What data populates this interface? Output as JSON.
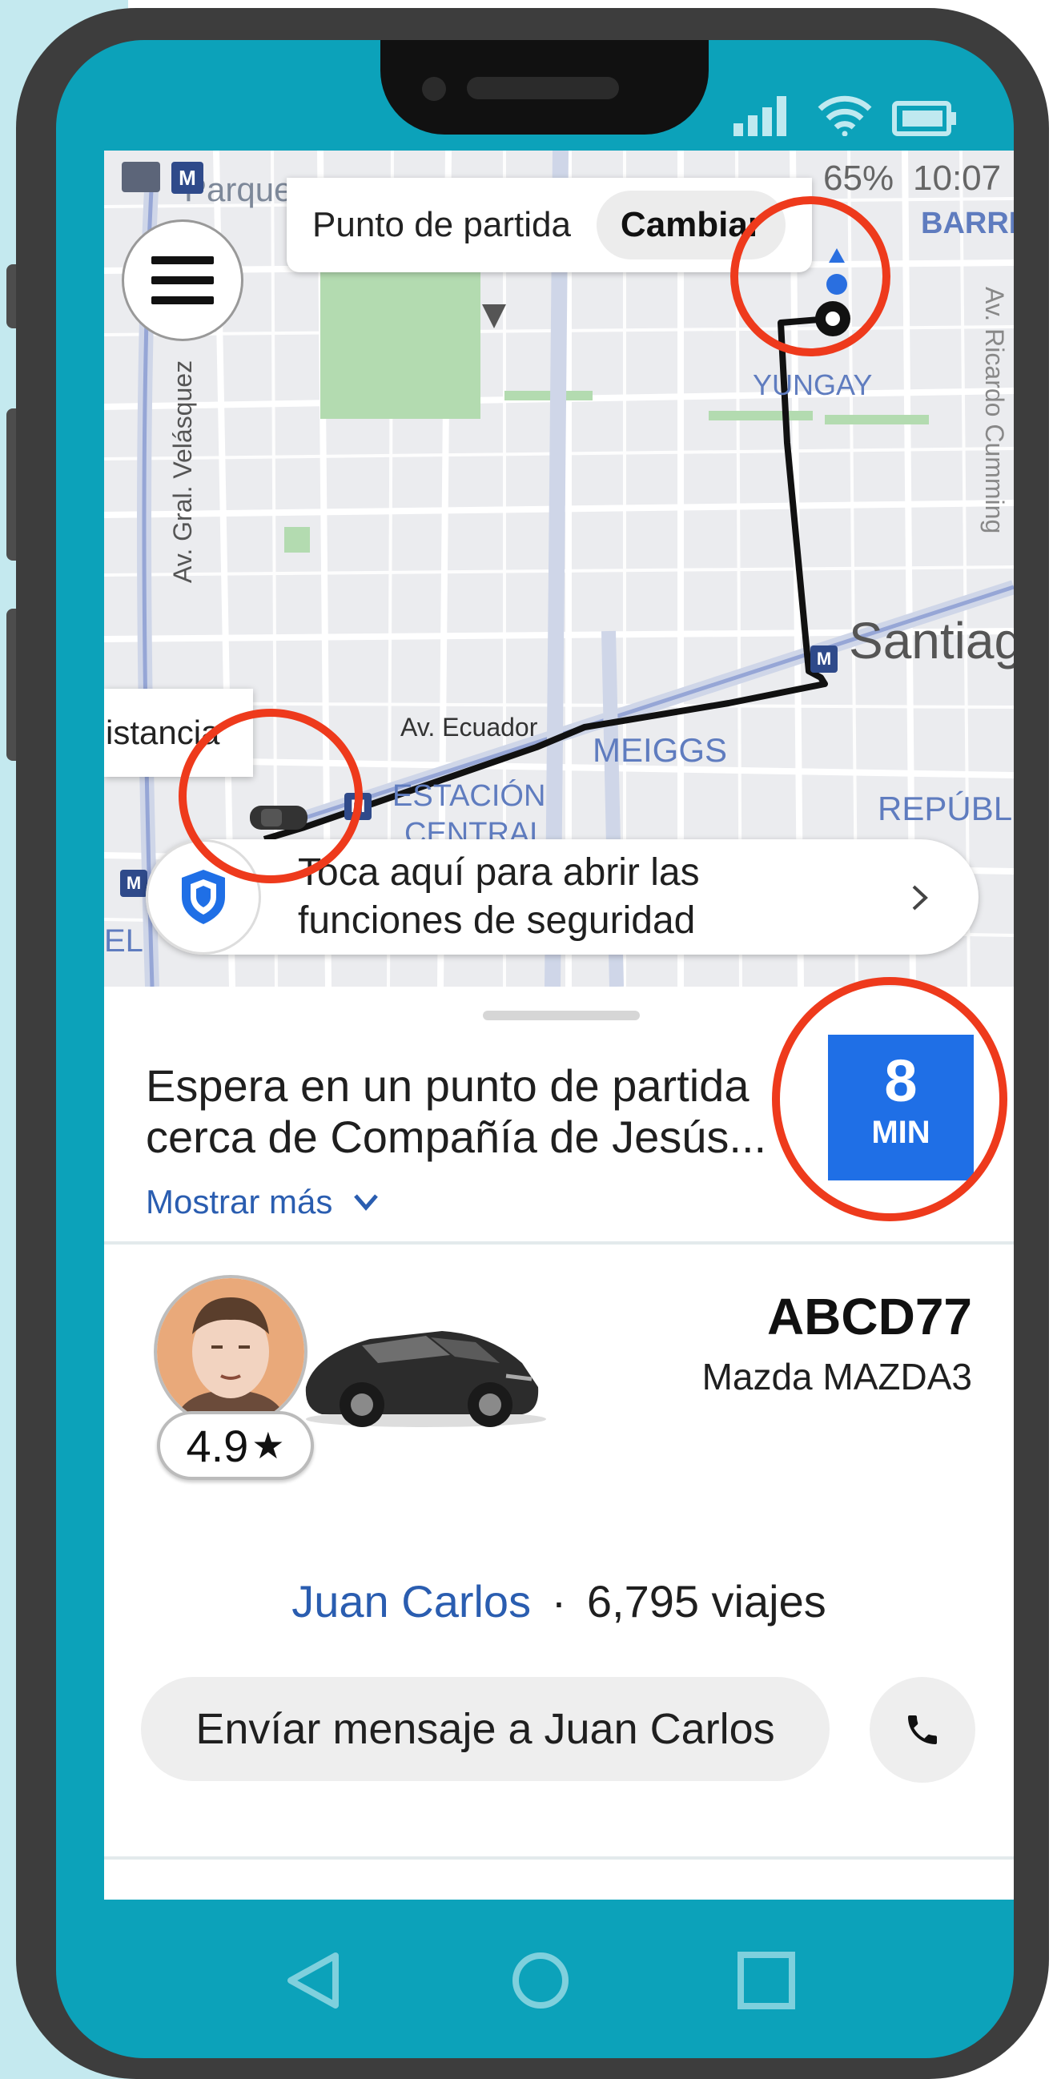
{
  "status_bar": {
    "icons": [
      "signal-icon",
      "wifi-icon",
      "battery-icon"
    ],
    "inner_time": "10:07",
    "inner_battery": "65%"
  },
  "map": {
    "pickup_label": "Punto de partida",
    "change_button": "Cambiar",
    "labels": {
      "parque": "Parque",
      "barrio": "BARRIO",
      "yungay": "YUNGAY",
      "gral_velasquez": "Av. Gral. Velásquez",
      "ricardo_cumming": "Av. Ricardo Cumming",
      "santiago": "Santiago",
      "ecuador": "Av. Ecuador",
      "meiggs": "MEIGGS",
      "estacion": "ESTACIÓN",
      "central": "CENTRAL",
      "republica": "REPÚBLICA",
      "distancia": "istancia",
      "el": "EL"
    },
    "safety_banner": "Toca aquí para abrir las funciones de seguridad",
    "safety_line1": "Toca aquí para abrir las",
    "safety_line2": "funciones de seguridad"
  },
  "trip": {
    "eta_line1": "Espera en un punto de partida",
    "eta_line2": "cerca de Compañía de Jesús...",
    "show_more": "Mostrar más",
    "eta_minutes": "8",
    "eta_unit": "MIN"
  },
  "driver": {
    "rating": "4.9",
    "rating_star": "★",
    "plate": "ABCD77",
    "car_model": "Mazda MAZDA3",
    "name": "Juan Carlos",
    "separator": "·",
    "trips": "6,795 viajes",
    "message_button": "Envíar mensaje a Juan Carlos"
  },
  "colors": {
    "accent_blue": "#1f6fe6",
    "highlight_ring": "#ee3a1c",
    "phone_teal": "#0ca2ba",
    "route_line": "#000000"
  }
}
